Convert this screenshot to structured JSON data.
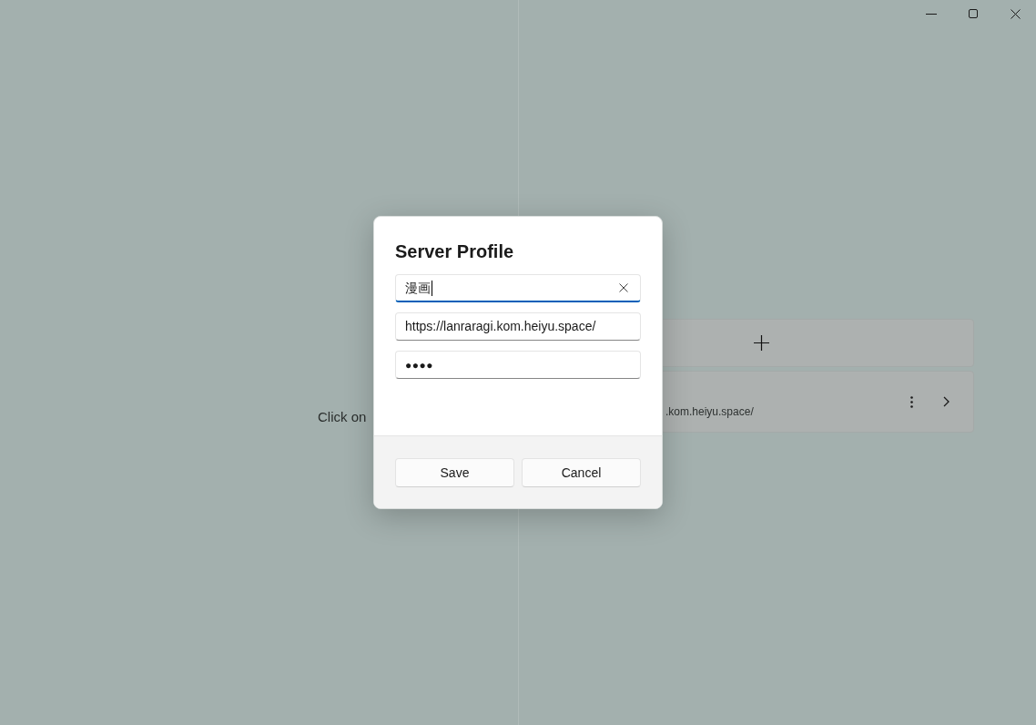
{
  "left_pane": {
    "hint": "Click on"
  },
  "server_card": {
    "address": ".kom.heiyu.space/"
  },
  "dialog": {
    "title": "Server Profile",
    "fields": [
      {
        "kind": "text",
        "value": "漫画",
        "focused": true
      },
      {
        "kind": "text",
        "value": "https://lanraragi.kom.heiyu.space/",
        "focused": false
      },
      {
        "kind": "password",
        "value": "●●●●",
        "focused": false
      }
    ],
    "buttons": [
      {
        "label": "Save"
      },
      {
        "label": "Cancel"
      }
    ]
  }
}
